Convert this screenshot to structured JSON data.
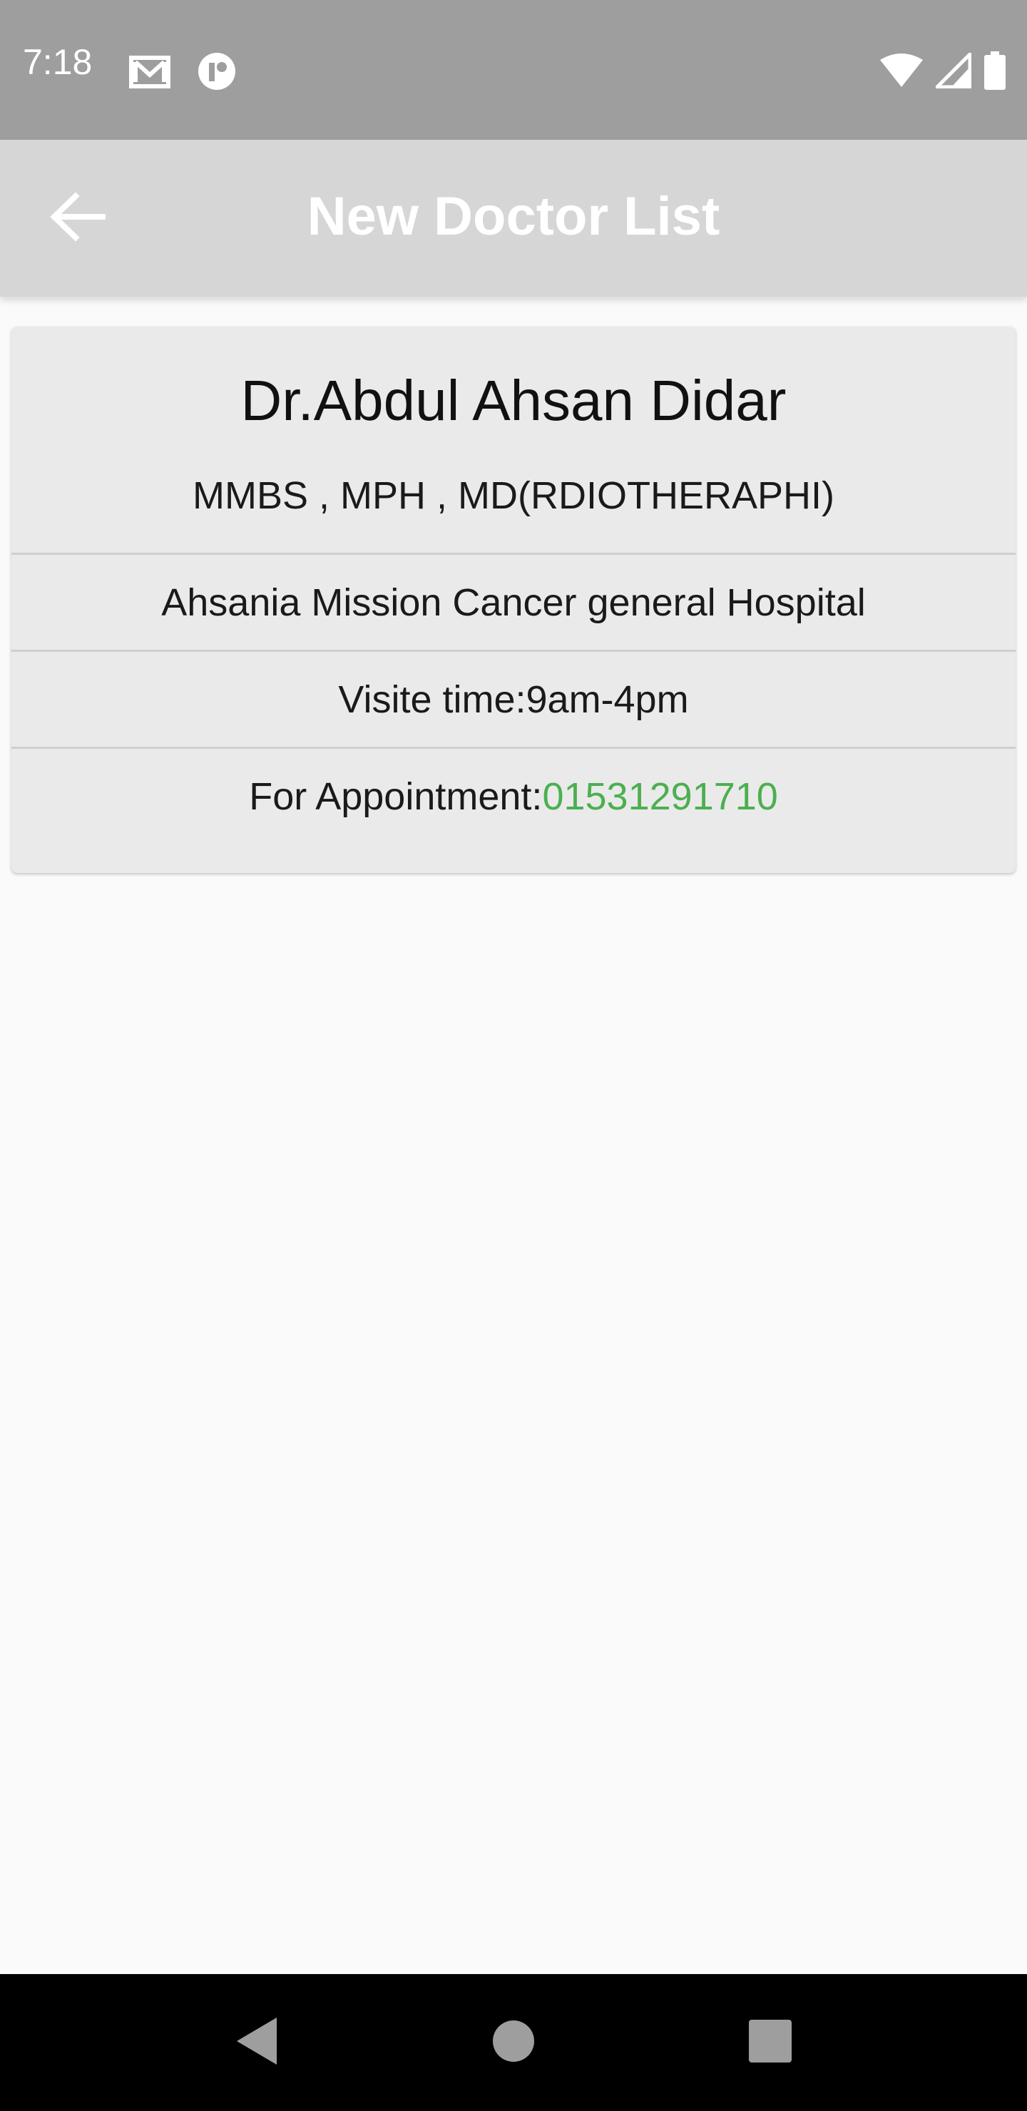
{
  "status_bar": {
    "time": "7:18",
    "left_icons": [
      "gmail-icon",
      "app-notification-icon"
    ],
    "right_icons": [
      "wifi-icon",
      "signal-icon",
      "battery-icon"
    ]
  },
  "app_bar": {
    "title": "New Doctor List",
    "back_icon": "arrow-left-icon"
  },
  "doctor_card": {
    "name": "Dr.Abdul Ahsan Didar",
    "degrees": "MMBS , MPH , MD(RDIOTHERAPHI)",
    "hospital": "Ahsania Mission Cancer general Hospital",
    "visit_time": "Visite time:9am-4pm",
    "appointment_label": "For Appointment:",
    "appointment_phone": "01531291710"
  },
  "nav_bar": {
    "icons": [
      "back-triangle-icon",
      "home-circle-icon",
      "recents-square-icon"
    ]
  },
  "colors": {
    "status_bar": "#9e9e9e",
    "app_bar": "#d6d6d6",
    "card": "#eaeaea",
    "phone": "#4caf50",
    "background": "#fafafa"
  }
}
